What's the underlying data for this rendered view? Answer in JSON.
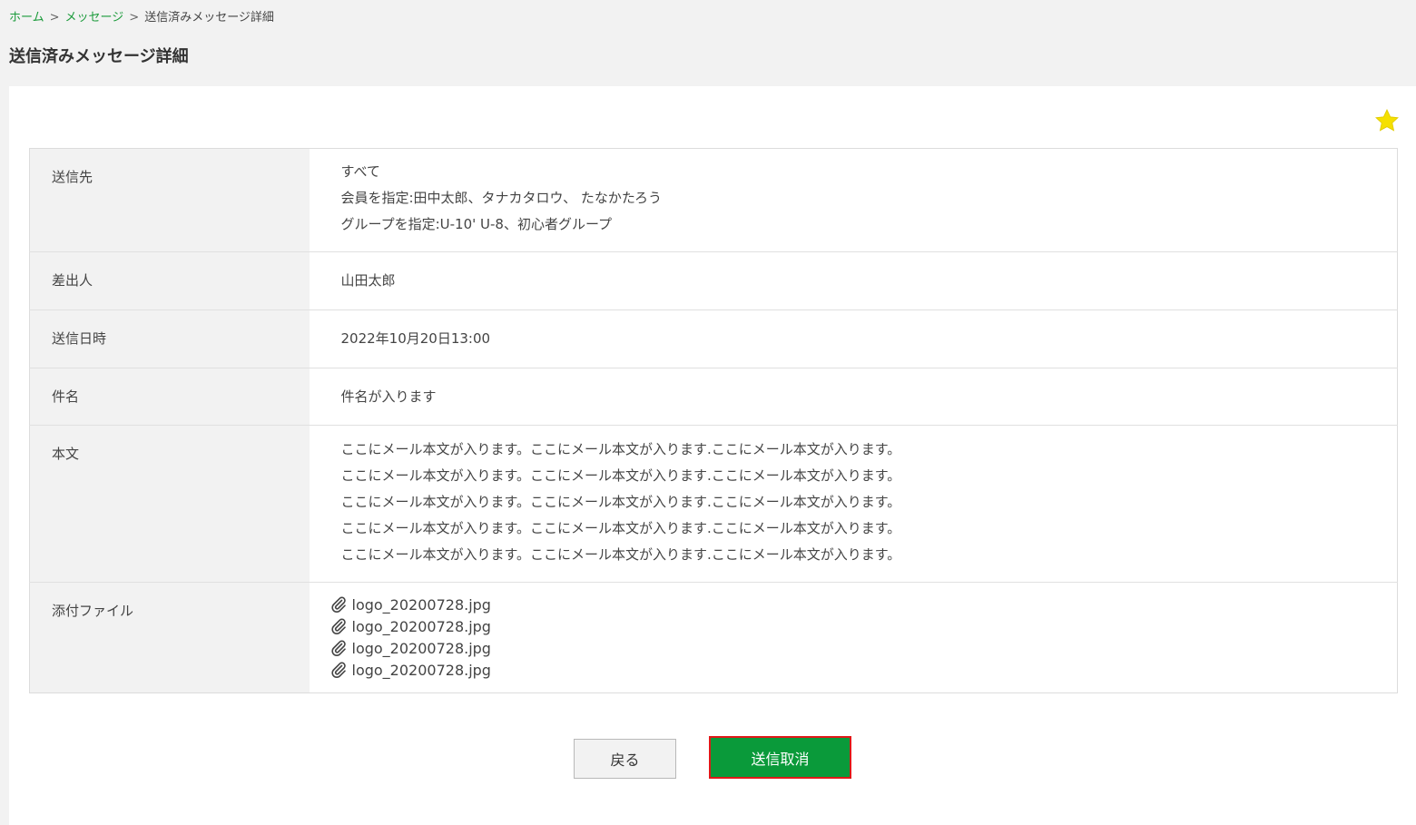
{
  "breadcrumb": {
    "home": "ホーム",
    "messages": "メッセージ",
    "current": "送信済みメッセージ詳細",
    "separator": ">"
  },
  "page_title": "送信済みメッセージ詳細",
  "detail": {
    "recipients_label": "送信先",
    "recipients": [
      "すべて",
      "会員を指定:田中太郎、タナカタロウ、 たなかたろう",
      "グループを指定:U-10' U-8、初心者グループ"
    ],
    "sender_label": "差出人",
    "sender": "山田太郎",
    "date_label": "送信日時",
    "date": "2022年10月20日13:00",
    "subject_label": "件名",
    "subject": "件名が入ります",
    "body_label": "本文",
    "body": [
      "ここにメール本文が入ります。ここにメール本文が入ります.ここにメール本文が入ります。",
      "ここにメール本文が入ります。ここにメール本文が入ります.ここにメール本文が入ります。",
      "ここにメール本文が入ります。ここにメール本文が入ります.ここにメール本文が入ります。",
      "ここにメール本文が入ります。ここにメール本文が入ります.ここにメール本文が入ります。",
      "ここにメール本文が入ります。ここにメール本文が入ります.ここにメール本文が入ります。"
    ],
    "attachments_label": "添付ファイル",
    "attachments": [
      "logo_20200728.jpg",
      "logo_20200728.jpg",
      "logo_20200728.jpg",
      "logo_20200728.jpg"
    ]
  },
  "buttons": {
    "back": "戻る",
    "cancel_send": "送信取消"
  },
  "icons": {
    "star": "star-icon",
    "attachment": "paperclip-icon"
  },
  "colors": {
    "accent_green": "#0a9a3a",
    "link_green": "#1a9a3a",
    "star_yellow": "#f5e000",
    "highlight_red": "#e01818"
  }
}
